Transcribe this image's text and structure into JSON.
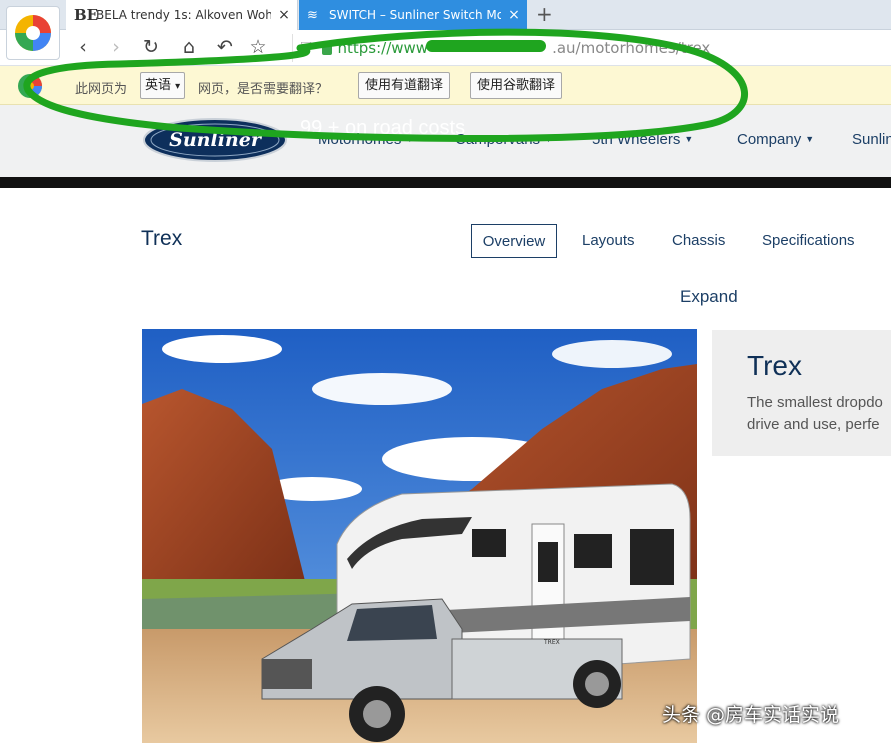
{
  "browser": {
    "tabs": [
      {
        "favicon": "BE",
        "title": "BELA trendy 1s: Alkoven Wohi",
        "close": "×"
      },
      {
        "favicon": "≋",
        "title": "SWITCH – Sunliner Switch Mo",
        "close": "×"
      }
    ],
    "new_tab": "+",
    "nav": {
      "back": "‹",
      "forward": "›",
      "reload": "↻",
      "home": "⌂",
      "undo": "↶",
      "bookmark": "☆"
    },
    "address": {
      "prefix": "https://www",
      "suffix": ".au/motorhomes/trex"
    }
  },
  "translate_bar": {
    "prefix": "此网页为",
    "language": "英语",
    "caret": "▾",
    "middle": "网页，是否需要翻译？",
    "youdao_button": "使用有道翻译",
    "google_button": "使用谷歌翻译"
  },
  "site": {
    "logo_text": "Sunliner",
    "ghost_text": "99 + on road costs",
    "menu": [
      {
        "label": "Motorhomes",
        "caret": "▼"
      },
      {
        "label": "Campervans",
        "caret": "▼"
      },
      {
        "label": "5th Wheelers",
        "caret": "▼"
      },
      {
        "label": "Company",
        "caret": "▼"
      },
      {
        "label": "Sunlin",
        "caret": ""
      }
    ],
    "page_title": "Trex",
    "subtabs": [
      "Overview",
      "Layouts",
      "Chassis",
      "Specifications"
    ],
    "expand": "Expand",
    "card": {
      "title": "Trex",
      "line1": "The smallest dropdo",
      "line2": "drive and use, perfe"
    },
    "hero": {
      "camper_badge": "TREX"
    }
  },
  "watermark": "头条 @房车实话实说",
  "colors": {
    "annotation": "#1fa51f",
    "brand": "#0f3057",
    "tab_active": "#2f8ee0",
    "translate_bar": "#fdf8d3"
  }
}
